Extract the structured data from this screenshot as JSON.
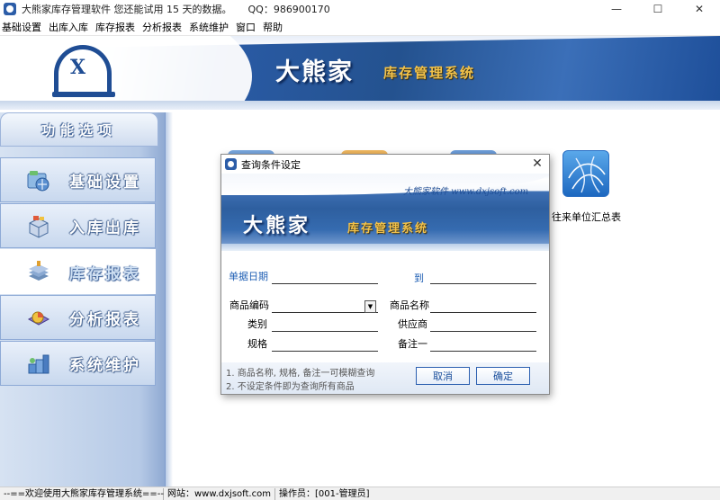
{
  "window": {
    "title": "大熊家库存管理软件   您还能试用 15 天的数据。",
    "qq": "QQ：986900170",
    "controls": {
      "minimize": "—",
      "maximize": "☐",
      "close": "✕"
    }
  },
  "menubar": {
    "items": [
      "基础设置",
      "出库入库",
      "库存报表",
      "分析报表",
      "系统维护",
      "窗口",
      "帮助"
    ]
  },
  "banner": {
    "logo_letter": "X",
    "name": "大熊家",
    "subtitle": "库存管理系统"
  },
  "sidebar": {
    "header": "功能选项",
    "items": [
      {
        "label": "基础设置",
        "icon": "globe-icon",
        "active": false
      },
      {
        "label": "入库出库",
        "icon": "box-icon",
        "active": false
      },
      {
        "label": "库存报表",
        "icon": "stack-icon",
        "active": true
      },
      {
        "label": "分析报表",
        "icon": "pie-chart-icon",
        "active": false
      },
      {
        "label": "系统维护",
        "icon": "tools-icon",
        "active": false
      }
    ]
  },
  "main": {
    "report_tiles": [
      {
        "label": "往来单位汇总表",
        "icon": "network-icon"
      }
    ]
  },
  "dialog": {
    "title": "查询条件设定",
    "close": "✕",
    "website": "大熊家软件  www.dxjsoft.com",
    "brand_name": "大熊家",
    "brand_subtitle": "库存管理系统",
    "fields": {
      "date_label": "单据日期",
      "date_from": "",
      "to_label": "到",
      "date_to": "",
      "code_label": "商品编码",
      "code_value": "",
      "name_label": "商品名称",
      "name_value": "",
      "category_label": "类别",
      "category_value": "",
      "supplier_label": "供应商",
      "supplier_value": "",
      "spec_label": "规格",
      "spec_value": "",
      "remark_label": "备注一",
      "remark_value": ""
    },
    "hints": [
      "1. 商品名称, 规格, 备注一可模糊查询",
      "2. 不设定条件即为查询所有商品"
    ],
    "cancel_label": "取消",
    "ok_label": "确定"
  },
  "statusbar": {
    "welcome": "--==欢迎使用大熊家库存管理系统==--",
    "website": "网站：www.dxjsoft.com",
    "operator": "操作员：[001-管理员]"
  },
  "colors": {
    "brand_blue": "#2a5ba6",
    "brand_gold": "#f2c24b",
    "panel_blue": "#b5c9e6"
  }
}
